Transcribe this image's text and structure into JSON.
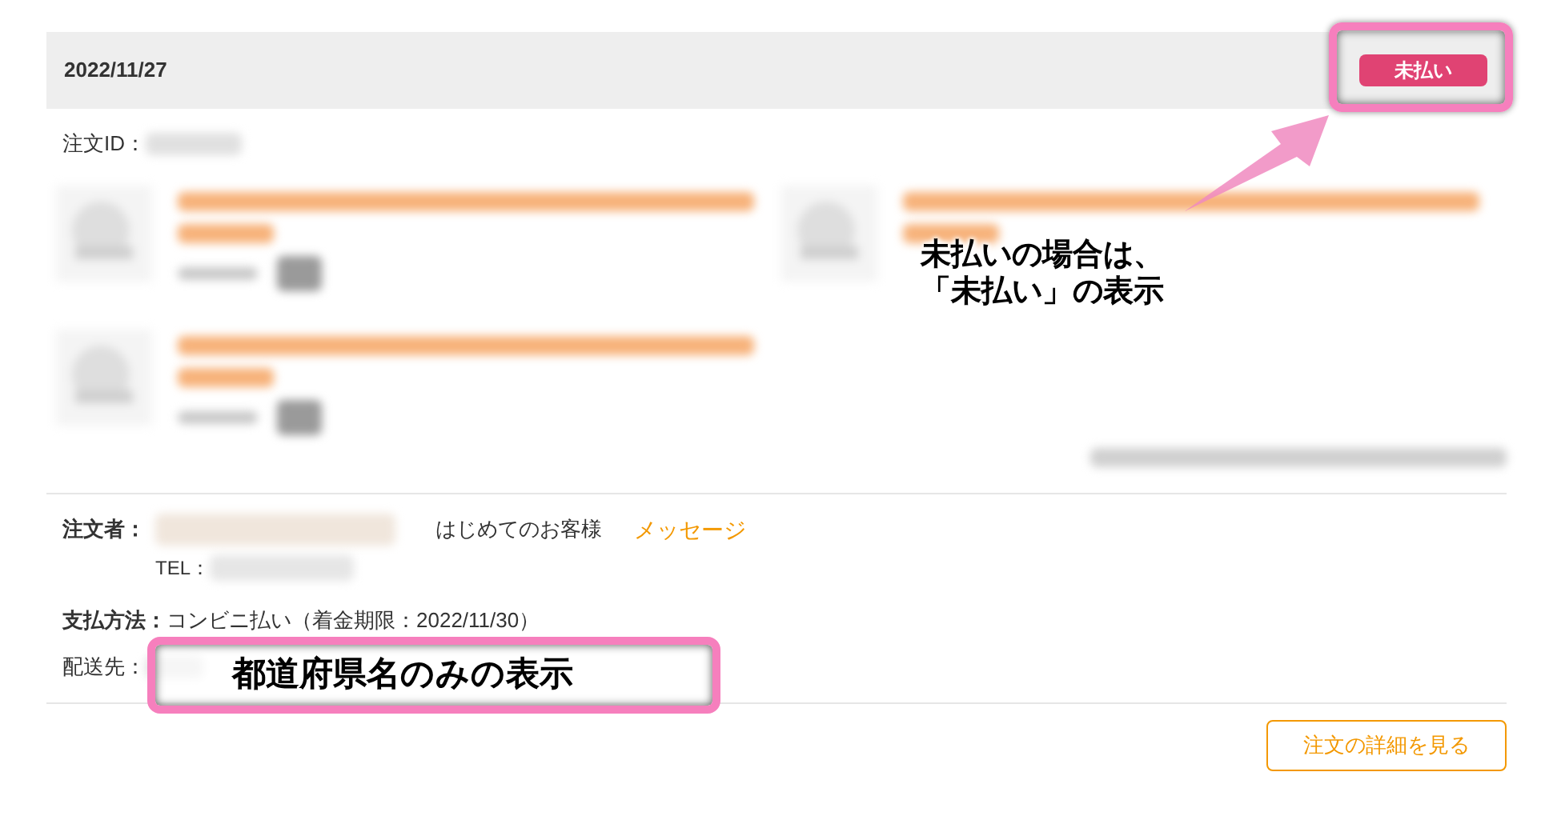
{
  "order": {
    "date": "2022/11/27",
    "status": {
      "label": "未払い",
      "kind": "unpaid"
    },
    "order_id_label": "注文ID："
  },
  "customer": {
    "orderer_label": "注文者：",
    "customer_type": "はじめてのお客様",
    "message_link": "メッセージ",
    "tel_label": "TEL："
  },
  "payment": {
    "label": "支払方法：",
    "value": "コンビニ払い（着金期限：2022/11/30）"
  },
  "shipping": {
    "label": "配送先："
  },
  "detail_button": "注文の詳細を見る",
  "annotations": [
    {
      "lines": [
        "未払いの場合は、",
        "「未払い」の表示"
      ]
    },
    {
      "lines": [
        "都道府県名のみの表示"
      ]
    }
  ]
}
